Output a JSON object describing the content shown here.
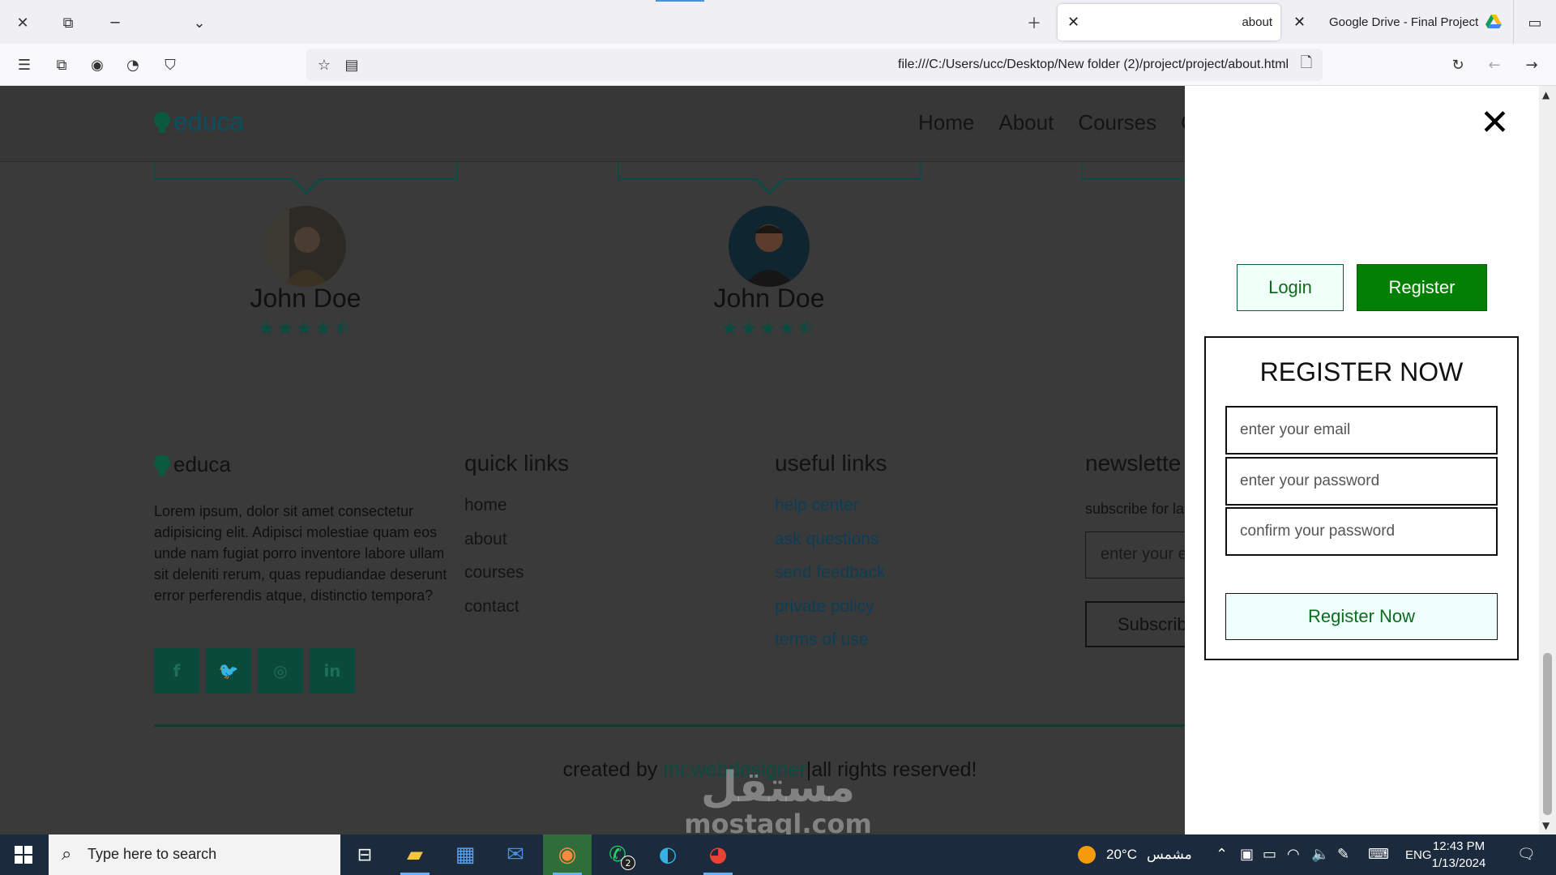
{
  "browser": {
    "tabs": [
      {
        "title": "about",
        "active": true
      },
      {
        "title": "Google Drive - Final Project",
        "active": false
      }
    ],
    "url": "file:///C:/Users/ucc/Desktop/New folder (2)/project/project/about.html"
  },
  "site": {
    "logo": "educa",
    "nav": [
      "Home",
      "About",
      "Courses",
      "C"
    ],
    "testimonials": [
      {
        "name": "John Doe",
        "rating": 4.5
      },
      {
        "name": "John Doe",
        "rating": 4.5
      }
    ],
    "footer": {
      "brand": "educa",
      "about_text": "Lorem ipsum, dolor sit amet consectetur adipisicing elit. Adipisci molestiae quam eos unde nam fugiat porro inventore labore ullam sit deleniti rerum, quas repudiandae deserunt error perferendis atque, distinctio tempora?",
      "quick_links": {
        "title": "quick links",
        "items": [
          "home",
          "about",
          "courses",
          "contact"
        ]
      },
      "useful_links": {
        "title": "useful links",
        "items": [
          "help center",
          "ask questions",
          "send feedback",
          "private policy",
          "terms of use"
        ]
      },
      "newsletter": {
        "title": "newslette",
        "text": "subscribe for la",
        "input_placeholder": "enter your e",
        "button": "Subscrib"
      },
      "credit_prefix": "created by ",
      "credit_author": "mr.webdesigner",
      "credit_suffix": "|all rights reserved!"
    },
    "watermark": {
      "arabic": "مستقل",
      "latin": "mostaql.com"
    }
  },
  "panel": {
    "login_label": "Login",
    "register_label": "Register",
    "form_title": "REGISTER NOW",
    "email_placeholder": "enter your email",
    "password_placeholder": "enter your password",
    "confirm_placeholder": "confirm your password",
    "submit_label": "Register Now"
  },
  "taskbar": {
    "search_placeholder": "Type here to search",
    "whatsapp_badge": "2",
    "weather_temp": "20°C",
    "weather_text": "مشمس",
    "language": "ENG",
    "time": "12:43 PM",
    "date": "1/13/2024"
  }
}
